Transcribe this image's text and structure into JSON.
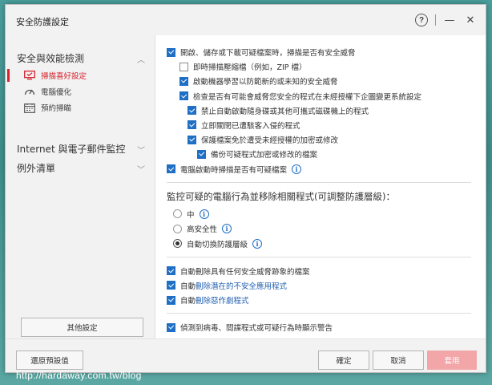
{
  "window": {
    "title": "安全防護設定"
  },
  "titlebar": {
    "help_glyph": "?",
    "minimize_glyph": "—",
    "close_glyph": "✕"
  },
  "sidebar": {
    "groups": [
      {
        "label": "安全與效能檢測",
        "expanded": true
      },
      {
        "label": "Internet 與電子郵件監控",
        "expanded": false
      },
      {
        "label": "例外清單",
        "expanded": false
      }
    ],
    "items": [
      {
        "label": "掃描喜好設定",
        "active": true,
        "icon": "monitor-icon"
      },
      {
        "label": "電腦優化",
        "active": false,
        "icon": "speedometer-icon"
      },
      {
        "label": "預約掃瞄",
        "active": false,
        "icon": "calendar-icon"
      }
    ],
    "other_button": "其他設定"
  },
  "options": [
    {
      "label": "開啟、儲存或下載可疑檔案時，掃描是否有安全威脅",
      "checked": true
    },
    {
      "label": "即時掃描壓縮檔（例如，ZIP 檔）",
      "checked": false
    },
    {
      "label": "啟動機器學習以防範新的或未知的安全威脅",
      "checked": true
    },
    {
      "label": "檢查是否有可能會威脅您安全的程式在未經授權下企圖變更系統設定",
      "checked": true
    },
    {
      "label": "禁止自動啟動隨身碟或其他可攜式磁碟機上的程式",
      "checked": true
    },
    {
      "label": "立即關閉已遭駭客入侵的程式",
      "checked": true
    },
    {
      "label": "保護檔案免於遭受未經授權的加密或修改",
      "checked": true
    },
    {
      "label": "備份可疑程式加密或修改的檔案",
      "checked": true
    },
    {
      "label": "電腦啟動時掃描是否有可疑檔案",
      "checked": true
    }
  ],
  "behavior": {
    "title": "監控可疑的電腦行為並移除相關程式(可調整防護層級)：",
    "radios": [
      {
        "label": "中",
        "selected": false
      },
      {
        "label": "高安全性",
        "selected": false
      },
      {
        "label": "自動切換防護層級",
        "selected": true
      }
    ]
  },
  "auto_delete": [
    {
      "label": "自動刪除具有任何安全威脅跡象的檔案",
      "checked": true
    },
    {
      "label_prefix": "自動",
      "label_link": "刪除潛在的不安全應用程式",
      "checked": true
    },
    {
      "label_prefix": "自動",
      "label_link": "刪除惡作劇程式",
      "checked": true
    }
  ],
  "warning": {
    "label": "偵測到病毒、間諜程式或可疑行為時顯示警告",
    "checked": true
  },
  "footer": {
    "reset": "還原預設值",
    "ok": "確定",
    "cancel": "取消",
    "apply": "套用"
  },
  "info_glyph": "i",
  "watermark": "http://hardaway.com.tw/blog",
  "colors": {
    "accent": "#d6232d",
    "check_blue": "#1f6fc5",
    "apply_disabled": "#f3a6a8",
    "link": "#1f5fb0"
  }
}
